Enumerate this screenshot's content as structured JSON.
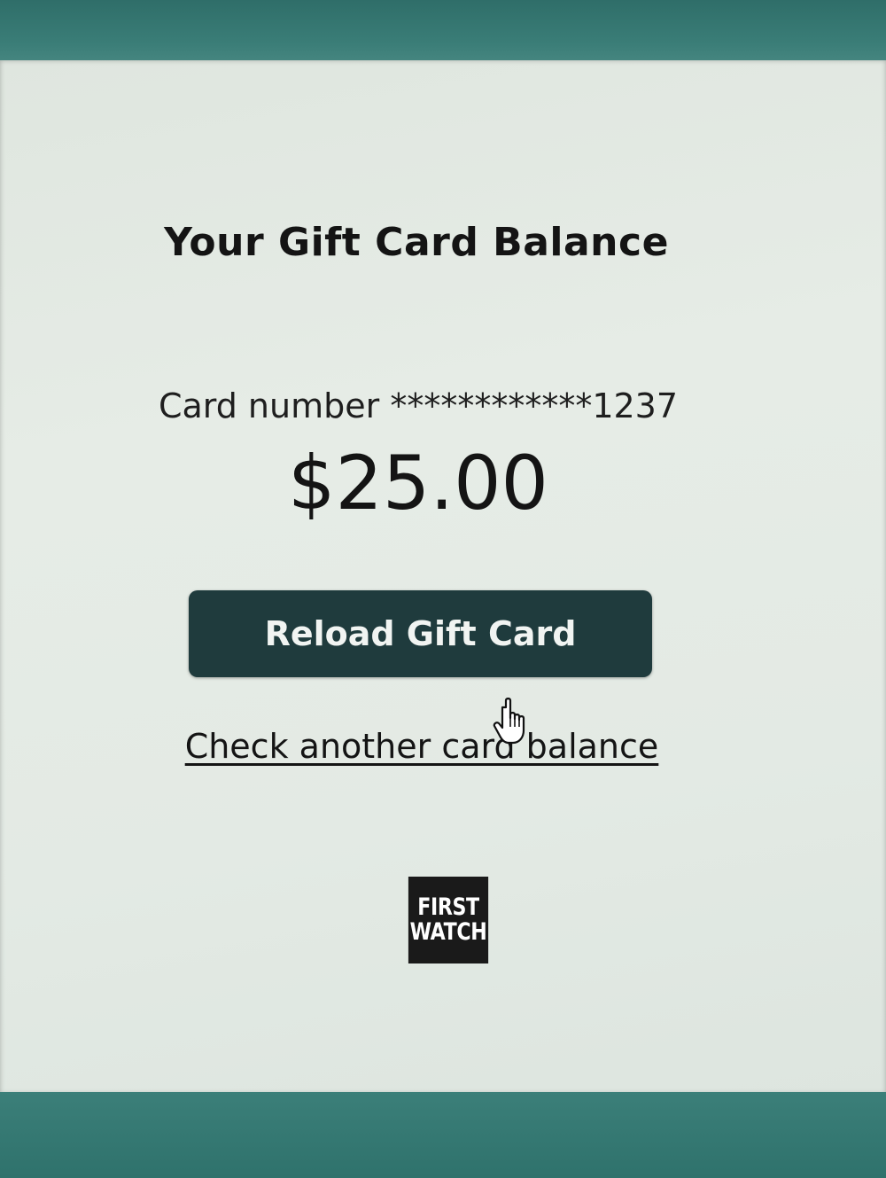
{
  "page": {
    "title": "Your Gift Card Balance",
    "card_number_label": "Card number",
    "card_number_masked": "************1237",
    "balance": "$25.00",
    "reload_button_label": "Reload Gift Card",
    "check_another_link": "Check another card balance"
  },
  "logo": {
    "line1": "FIRST",
    "line2": "WATCH"
  },
  "colors": {
    "button_bg": "#1f3b3d",
    "frame_teal": "#3f7f7a",
    "panel_bg": "#e3eae4"
  },
  "icons": {
    "cursor": "hand-pointer-icon"
  }
}
